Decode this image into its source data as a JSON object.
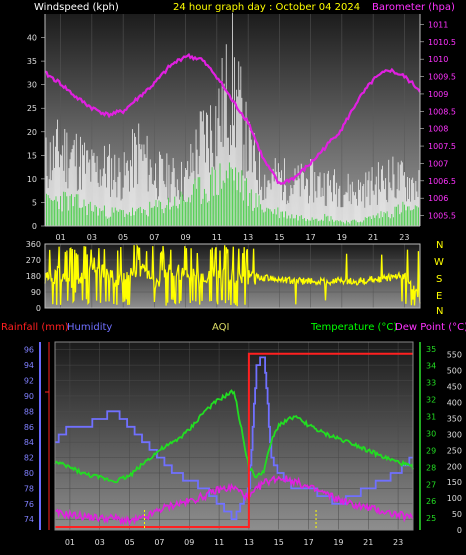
{
  "top_panel": {
    "label_left": "Windspeed (kph)",
    "title": "24 hour graph day : October 04 2024",
    "label_right": "Barometer (hpa)"
  },
  "middle_panel": {
    "compass": [
      "N",
      "W",
      "S",
      "E",
      "N"
    ]
  },
  "bottom_panel": {
    "label_rainfall": "Rainfall (mm)",
    "label_humidity": "Humidity",
    "label_aqi": "AQI",
    "label_temperature": "Temperature (°C)",
    "label_dewpoint": "Dew Point (°C)"
  },
  "colors": {
    "wind": "#ffffff",
    "wind_avg": "#2ecc2e",
    "barometer": "#e020e0",
    "direction": "#ffff00",
    "rainfall": "#ff2020",
    "humidity": "#7070ff",
    "temperature": "#22dd22",
    "dewpoint": "#e020e0",
    "aqi_color": "#ffff00",
    "label_title": "#ffff00",
    "label_temp": "#00ff00"
  },
  "chart_data": [
    {
      "type": "line",
      "x_ticks": [
        "01",
        "03",
        "05",
        "07",
        "09",
        "11",
        "13",
        "15",
        "17",
        "19",
        "21",
        "23"
      ],
      "y_left_ticks": [
        0,
        5,
        10,
        15,
        20,
        25,
        30,
        35,
        40
      ],
      "y_left_range": [
        0,
        45
      ],
      "y_right_ticks": [
        "1005.5",
        "1006",
        "1006.5",
        "1007",
        "1007.5",
        "1008",
        "1008.5",
        "1009",
        "1009.5",
        "1010",
        "1010.5",
        "1011"
      ],
      "y_right_range": [
        1005.2,
        1011.3
      ],
      "series": [
        {
          "name": "Barometer (hpa)",
          "axis": "right",
          "x": [
            0,
            1,
            2,
            3,
            4,
            5,
            6,
            7,
            8,
            9,
            10,
            11,
            12,
            13,
            14,
            15,
            16,
            17,
            18,
            19,
            20,
            21,
            22,
            23,
            24
          ],
          "values": [
            1009.6,
            1009.3,
            1008.9,
            1008.6,
            1008.4,
            1008.5,
            1008.9,
            1009.3,
            1009.8,
            1010.1,
            1010.0,
            1009.5,
            1008.8,
            1008.2,
            1007.1,
            1006.4,
            1006.6,
            1007.0,
            1007.5,
            1008.0,
            1008.8,
            1009.4,
            1009.7,
            1009.5,
            1009.1
          ]
        },
        {
          "name": "Windspeed (kph)",
          "axis": "left",
          "x": [
            0,
            1,
            2,
            3,
            4,
            5,
            6,
            7,
            8,
            9,
            10,
            11,
            12,
            13,
            14,
            15,
            16,
            17,
            18,
            19,
            20,
            21,
            22,
            23,
            24
          ],
          "values": [
            18,
            22,
            20,
            16,
            17,
            14,
            22,
            15,
            14,
            13,
            25,
            30,
            42,
            22,
            13,
            14,
            12,
            13,
            12,
            11,
            10,
            12,
            14,
            13,
            12
          ]
        },
        {
          "name": "Wind average",
          "axis": "left",
          "x": [
            0,
            1,
            2,
            3,
            4,
            5,
            6,
            7,
            8,
            9,
            10,
            11,
            12,
            13,
            14,
            15,
            16,
            17,
            18,
            19,
            20,
            21,
            22,
            23,
            24
          ],
          "values": [
            5,
            6,
            5,
            4,
            3,
            3,
            3,
            4,
            5,
            6,
            8,
            10,
            12,
            7,
            4,
            3,
            2,
            2,
            2,
            1,
            1,
            2,
            3,
            4,
            3
          ]
        }
      ]
    },
    {
      "type": "line",
      "x_ticks": [
        "01",
        "03",
        "05",
        "07",
        "09",
        "11",
        "13",
        "15",
        "17",
        "19",
        "21",
        "23"
      ],
      "y_ticks": [
        0,
        90,
        180,
        270,
        360
      ],
      "y_range": [
        0,
        360
      ],
      "series": [
        {
          "name": "Wind direction",
          "x": [
            0,
            1,
            2,
            3,
            4,
            5,
            6,
            7,
            8,
            9,
            10,
            11,
            12,
            13,
            14,
            15,
            16,
            17,
            18,
            19,
            20,
            21,
            22,
            23,
            24
          ],
          "values": [
            150,
            200,
            120,
            250,
            180,
            160,
            230,
            140,
            210,
            190,
            170,
            200,
            180,
            175,
            170,
            160,
            150,
            150,
            150,
            155,
            150,
            160,
            170,
            180,
            60
          ]
        }
      ]
    },
    {
      "type": "line",
      "x_ticks": [
        "01",
        "03",
        "05",
        "07",
        "09",
        "11",
        "13",
        "15",
        "17",
        "19",
        "21",
        "23"
      ],
      "y_humidity_ticks": [
        74,
        76,
        78,
        80,
        82,
        84,
        86,
        88,
        90,
        92,
        94,
        96
      ],
      "y_humidity_range": [
        72.6,
        97
      ],
      "y_temp_ticks": [
        25,
        26,
        27,
        28,
        29,
        30,
        31,
        32,
        33,
        34,
        35
      ],
      "y_temp_range": [
        24.3,
        35.4
      ],
      "y_aqi_ticks": [
        0,
        50,
        100,
        150,
        200,
        250,
        300,
        350,
        400,
        450,
        500,
        550
      ],
      "y_aqi_range": [
        0,
        590
      ],
      "series": [
        {
          "name": "Humidity",
          "x": [
            0,
            1,
            2,
            3,
            4,
            5,
            6,
            7,
            8,
            9,
            10,
            11,
            12,
            13,
            13.5,
            14,
            14.5,
            15,
            16,
            17,
            18,
            19,
            20,
            21,
            22,
            23,
            24
          ],
          "values": [
            84,
            86,
            86,
            87,
            88,
            86,
            84,
            82,
            80,
            79,
            78,
            76,
            74,
            78,
            94,
            95,
            82,
            80,
            78,
            78,
            77,
            76,
            77,
            78,
            79,
            80,
            82
          ]
        },
        {
          "name": "Temperature (°C)",
          "x": [
            0,
            1,
            2,
            3,
            4,
            5,
            6,
            7,
            8,
            9,
            10,
            11,
            12,
            13,
            13.5,
            14,
            14.5,
            15,
            16,
            17,
            18,
            19,
            20,
            21,
            22,
            23,
            24
          ],
          "values": [
            28.3,
            28,
            27.6,
            27.4,
            27.2,
            27.5,
            28.3,
            29,
            29.5,
            30.2,
            31.3,
            32,
            32.5,
            28,
            27.4,
            27.8,
            29.5,
            30.5,
            31,
            30.5,
            30,
            29.7,
            29.4,
            29,
            28.6,
            28.3,
            28
          ]
        },
        {
          "name": "Dew Point (°C)",
          "x": [
            0,
            1,
            2,
            3,
            4,
            5,
            6,
            7,
            8,
            9,
            10,
            11,
            12,
            13,
            14,
            15,
            16,
            17,
            18,
            19,
            20,
            21,
            22,
            23,
            24
          ],
          "values": [
            25.3,
            25.2,
            25.1,
            25,
            25,
            24.8,
            25,
            25.5,
            25.8,
            26,
            26.3,
            26.7,
            26.8,
            26.2,
            27.1,
            27.4,
            27.2,
            26.8,
            26.5,
            26.1,
            25.8,
            25.6,
            25.4,
            25.2,
            25
          ]
        },
        {
          "name": "Rainfall (mm)",
          "x": [
            0,
            5,
            10,
            12.6,
            13,
            17,
            20,
            24
          ],
          "values": [
            0,
            0,
            0,
            0,
            10,
            10,
            10,
            10
          ]
        }
      ]
    }
  ]
}
